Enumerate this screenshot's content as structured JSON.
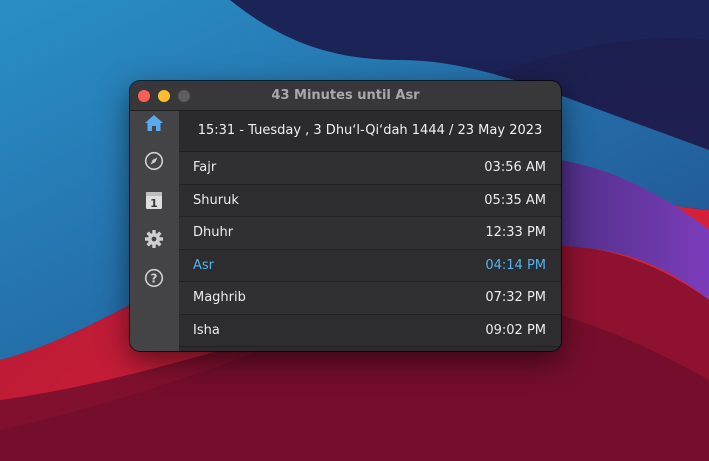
{
  "window": {
    "title": "43 Minutes until Asr"
  },
  "header": {
    "date_line": "15:31 - Tuesday , 3 Dhuʻl-Qiʻdah 1444 / 23 May 2023"
  },
  "sidebar": {
    "items": [
      {
        "id": "home",
        "icon": "home-icon",
        "active": true
      },
      {
        "id": "compass",
        "icon": "compass-icon",
        "active": false
      },
      {
        "id": "calendar",
        "icon": "calendar-icon",
        "label": "1",
        "active": false
      },
      {
        "id": "settings",
        "icon": "gear-icon",
        "active": false
      },
      {
        "id": "help",
        "icon": "help-icon",
        "label": "?",
        "active": false
      }
    ]
  },
  "prayers": [
    {
      "name": "Fajr",
      "time": "03:56 AM"
    },
    {
      "name": "Shuruk",
      "time": "05:35 AM"
    },
    {
      "name": "Dhuhr",
      "time": "12:33 PM"
    },
    {
      "name": "Asr",
      "time": "04:14 PM",
      "current": true
    },
    {
      "name": "Maghrib",
      "time": "07:32 PM"
    },
    {
      "name": "Isha",
      "time": "09:02 PM"
    }
  ],
  "colors": {
    "accent": "#4fb3f0",
    "active_icon": "#5aaaf0"
  }
}
